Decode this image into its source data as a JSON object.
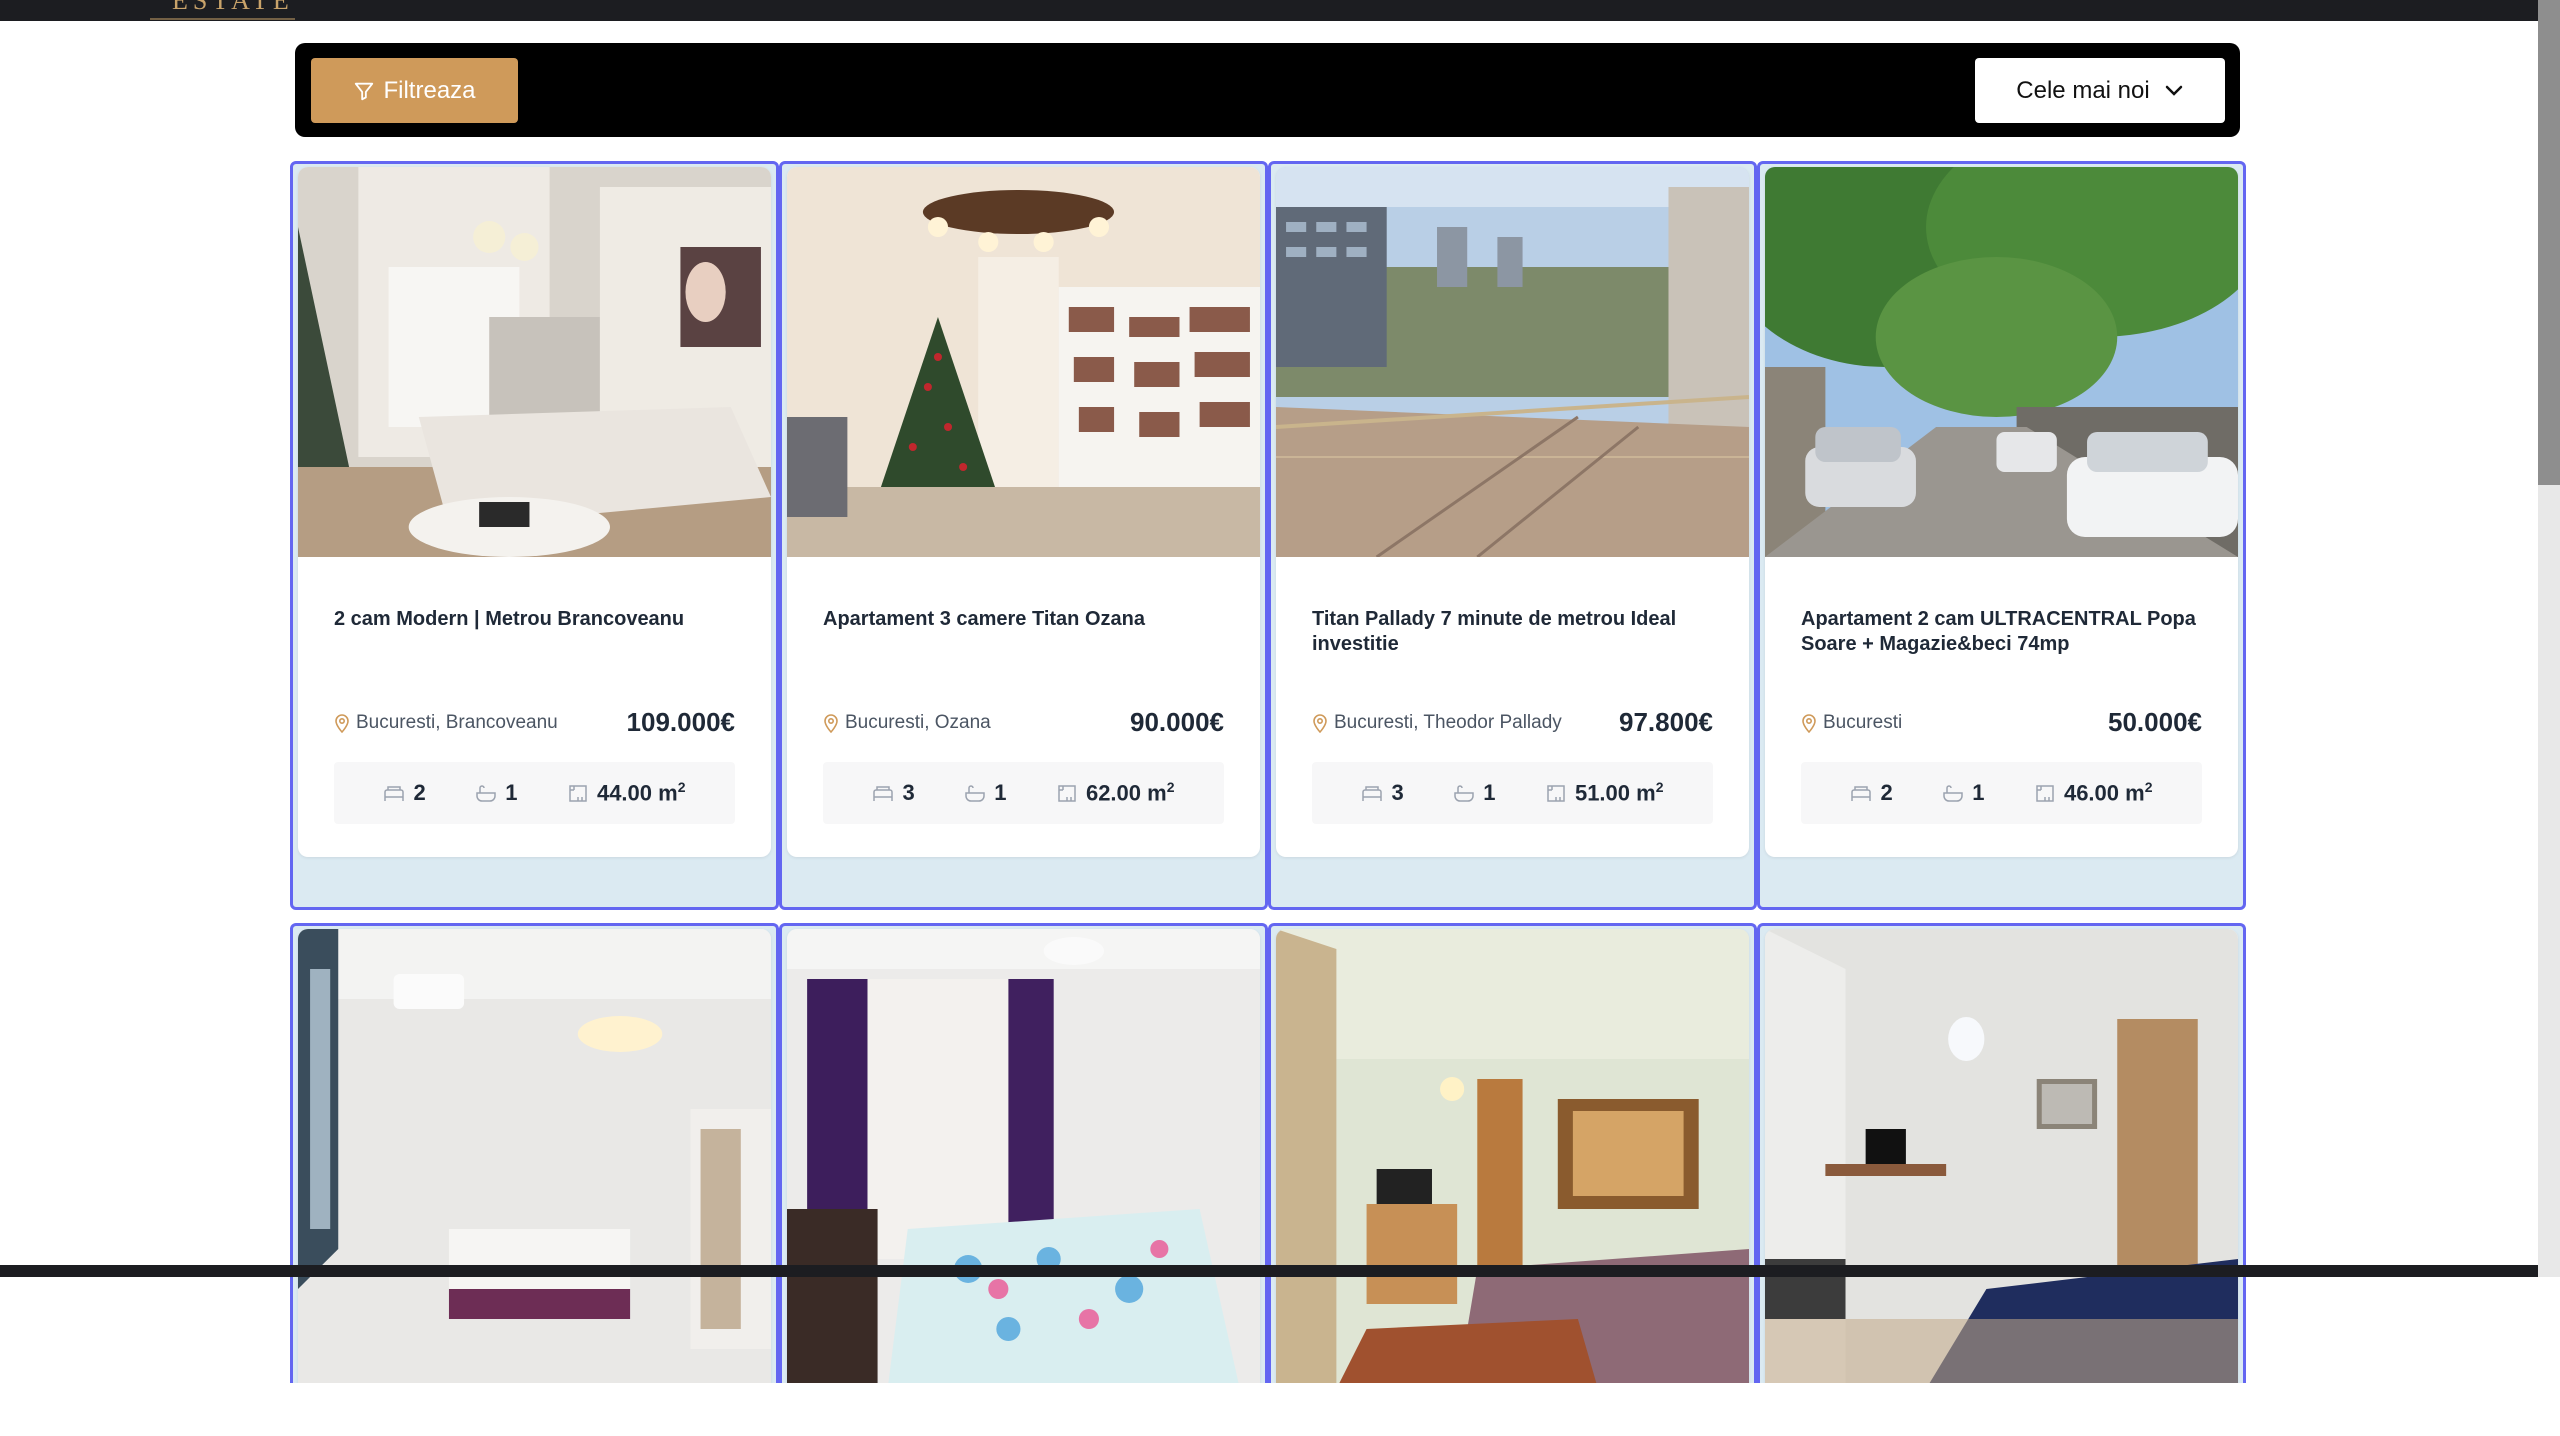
{
  "header": {
    "logo_text": "ESTATE"
  },
  "toolbar": {
    "filter_label": "Filtreaza",
    "sort_label": "Cele mai noi"
  },
  "area_unit": "m",
  "area_exp": "2",
  "listings": [
    {
      "title": "2 cam Modern | Metrou Brancoveanu",
      "location": "Bucuresti, Brancoveanu",
      "price": "109.000€",
      "rooms": "2",
      "baths": "1",
      "area": "44.00",
      "photo": "living-room-with-christmas-tree"
    },
    {
      "title": "Apartament 3 camere Titan Ozana",
      "location": "Bucuresti, Ozana",
      "price": "90.000€",
      "rooms": "3",
      "baths": "1",
      "area": "62.00",
      "photo": "room-with-christmas-tree-and-bookshelf"
    },
    {
      "title": "Titan Pallady 7 minute de metrou Ideal investitie",
      "location": "Bucuresti, Theodor Pallady",
      "price": "97.800€",
      "rooms": "3",
      "baths": "1",
      "area": "51.00",
      "photo": "balcony-city-view"
    },
    {
      "title": "Apartament 2 cam ULTRACENTRAL Popa Soare + Magazie&beci 74mp",
      "location": "Bucuresti",
      "price": "50.000€",
      "rooms": "2",
      "baths": "1",
      "area": "46.00",
      "photo": "street-with-parked-cars"
    }
  ],
  "more_photos": [
    "bedroom-with-air-conditioner",
    "bedroom-with-purple-curtains",
    "living-room-with-carpet",
    "living-room-with-blue-sofa"
  ],
  "colors": {
    "accent": "#cf9a5a",
    "card_border": "#6366f1",
    "filter_bar": "#000000"
  }
}
